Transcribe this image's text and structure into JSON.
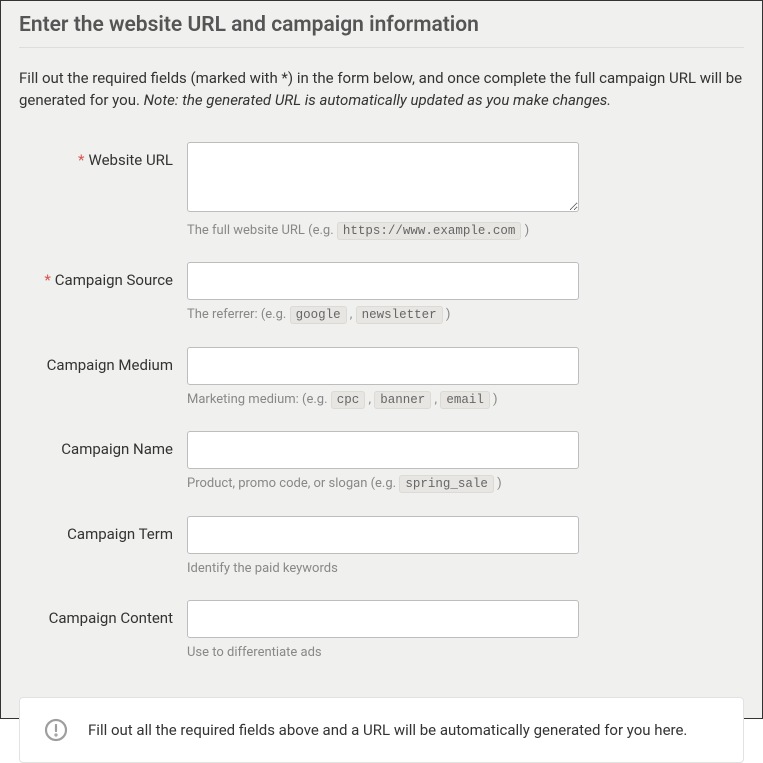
{
  "heading": "Enter the website URL and campaign information",
  "intro_text": "Fill out the required fields (marked with *) in the form below, and once complete the full campaign URL will be generated for you. ",
  "intro_note": "Note: the generated URL is automatically updated as you make changes.",
  "required_mark": "*",
  "fields": {
    "website_url": {
      "label": "Website URL",
      "value": "",
      "hint_prefix": "The full website URL (e.g. ",
      "hint_code": "https://www.example.com",
      "hint_suffix": " )"
    },
    "campaign_source": {
      "label": "Campaign Source",
      "value": "",
      "hint_prefix": "The referrer: (e.g. ",
      "hint_code1": "google",
      "hint_sep": " , ",
      "hint_code2": "newsletter",
      "hint_suffix": " )"
    },
    "campaign_medium": {
      "label": "Campaign Medium",
      "value": "",
      "hint_prefix": "Marketing medium: (e.g. ",
      "hint_code1": "cpc",
      "hint_sep1": " , ",
      "hint_code2": "banner",
      "hint_sep2": " , ",
      "hint_code3": "email",
      "hint_suffix": " )"
    },
    "campaign_name": {
      "label": "Campaign Name",
      "value": "",
      "hint_prefix": "Product, promo code, or slogan (e.g. ",
      "hint_code": "spring_sale",
      "hint_suffix": " )"
    },
    "campaign_term": {
      "label": "Campaign Term",
      "value": "",
      "hint": "Identify the paid keywords"
    },
    "campaign_content": {
      "label": "Campaign Content",
      "value": "",
      "hint": "Use to differentiate ads"
    }
  },
  "result_message": "Fill out all the required fields above and a URL will be automatically generated for you here."
}
